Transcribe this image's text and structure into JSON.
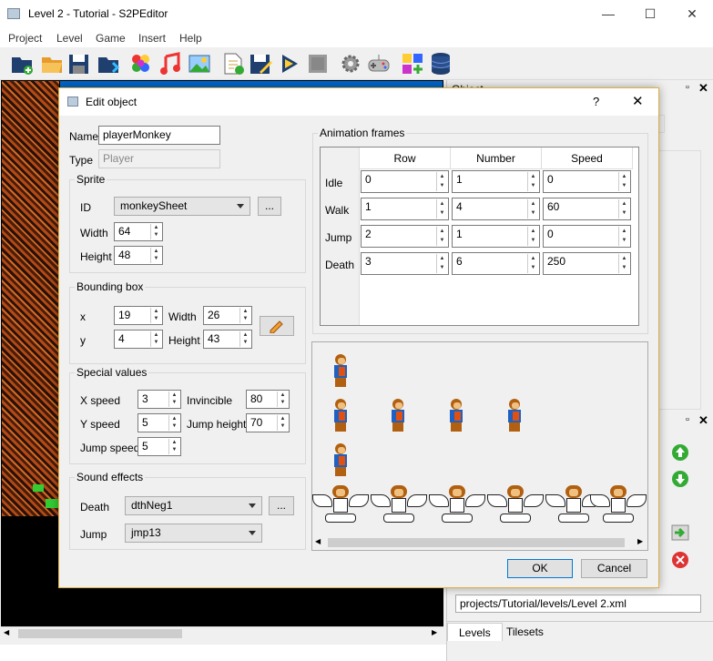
{
  "window": {
    "title": "Level 2 - Tutorial - S2PEditor",
    "minimize": "—",
    "maximize": "☐",
    "close": "✕"
  },
  "menubar": [
    "Project",
    "Level",
    "Game",
    "Insert",
    "Help"
  ],
  "toolbar_icons": [
    "new-project-icon",
    "open-folder-icon",
    "save-icon",
    "export-icon",
    "palette-icon",
    "music-icon",
    "image-icon",
    "new-level-icon",
    "save-level-icon",
    "play-icon",
    "stop-icon",
    "settings-icon",
    "gamepad-icon",
    "add-object-icon",
    "database-icon"
  ],
  "right_panel": {
    "top_dock_title": "Object",
    "level_path": "projects/Tutorial/levels/Level 2.xml",
    "tabs": [
      "Levels",
      "Tilesets"
    ]
  },
  "dialog": {
    "title": "Edit object",
    "help": "?",
    "close": "✕",
    "name_label": "Name",
    "name_value": "playerMonkey",
    "type_label": "Type",
    "type_value": "Player",
    "sprite": {
      "title": "Sprite",
      "id_label": "ID",
      "id_value": "monkeySheet",
      "browse": "...",
      "width_label": "Width",
      "width_value": "64",
      "height_label": "Height",
      "height_value": "48"
    },
    "bbox": {
      "title": "Bounding box",
      "x_label": "x",
      "x_value": "19",
      "y_label": "y",
      "y_value": "4",
      "width_label": "Width",
      "width_value": "26",
      "height_label": "Height",
      "height_value": "43"
    },
    "special": {
      "title": "Special values",
      "xspeed_label": "X speed",
      "xspeed_value": "3",
      "yspeed_label": "Y speed",
      "yspeed_value": "5",
      "jumpspeed_label": "Jump speed",
      "jumpspeed_value": "5",
      "invincible_label": "Invincible",
      "invincible_value": "80",
      "jumpheight_label": "Jump height",
      "jumpheight_value": "70"
    },
    "sound": {
      "title": "Sound effects",
      "death_label": "Death",
      "death_value": "dthNeg1",
      "browse": "...",
      "jump_label": "Jump",
      "jump_value": "jmp13"
    },
    "animation": {
      "title": "Animation frames",
      "columns": [
        "Row",
        "Number",
        "Speed"
      ],
      "rows": [
        {
          "label": "Idle",
          "values": [
            "0",
            "1",
            "0"
          ]
        },
        {
          "label": "Walk",
          "values": [
            "1",
            "4",
            "60"
          ]
        },
        {
          "label": "Jump",
          "values": [
            "2",
            "1",
            "0"
          ]
        },
        {
          "label": "Death",
          "values": [
            "3",
            "6",
            "250"
          ]
        }
      ]
    },
    "ok": "OK",
    "cancel": "Cancel"
  }
}
